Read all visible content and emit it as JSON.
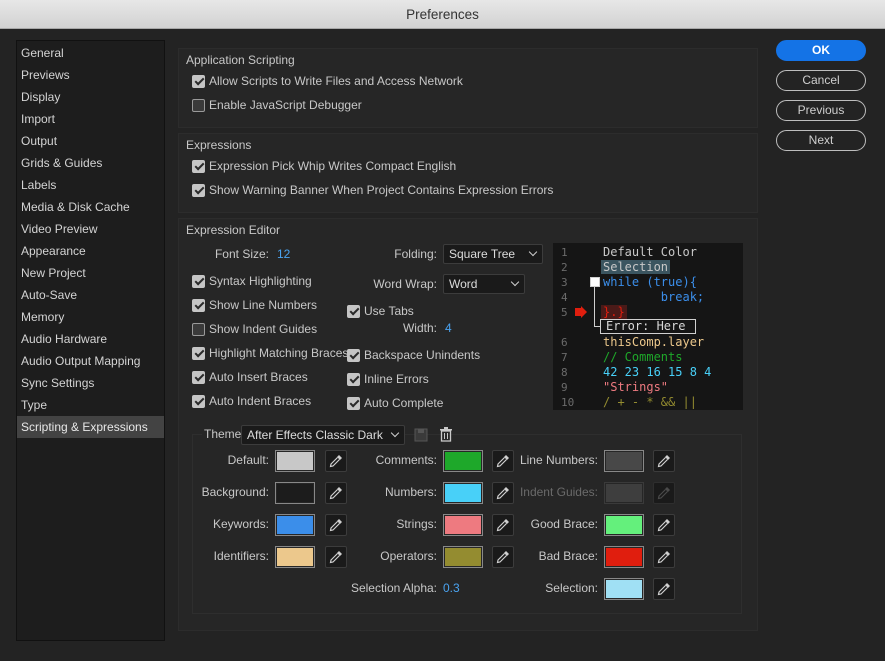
{
  "window": {
    "title": "Preferences"
  },
  "sidebar": {
    "items": [
      {
        "label": "General"
      },
      {
        "label": "Previews"
      },
      {
        "label": "Display"
      },
      {
        "label": "Import"
      },
      {
        "label": "Output"
      },
      {
        "label": "Grids & Guides"
      },
      {
        "label": "Labels"
      },
      {
        "label": "Media & Disk Cache"
      },
      {
        "label": "Video Preview"
      },
      {
        "label": "Appearance"
      },
      {
        "label": "New Project"
      },
      {
        "label": "Auto-Save"
      },
      {
        "label": "Memory"
      },
      {
        "label": "Audio Hardware"
      },
      {
        "label": "Audio Output Mapping"
      },
      {
        "label": "Sync Settings"
      },
      {
        "label": "Type"
      },
      {
        "label": "Scripting & Expressions"
      }
    ],
    "selected": "Scripting & Expressions"
  },
  "app_scripting": {
    "title": "Application Scripting",
    "allow_scripts": {
      "label": "Allow Scripts to Write Files and Access Network",
      "checked": true
    },
    "enable_debugger": {
      "label": "Enable JavaScript Debugger",
      "checked": false
    }
  },
  "expressions": {
    "title": "Expressions",
    "pick_whip": {
      "label": "Expression Pick Whip Writes Compact English",
      "checked": true
    },
    "warning_banner": {
      "label": "Show Warning Banner When Project Contains Expression Errors",
      "checked": true
    }
  },
  "editor": {
    "title": "Expression Editor",
    "font_size_label": "Font Size:",
    "font_size_value": "12",
    "folding_label": "Folding:",
    "folding_value": "Square Tree",
    "word_wrap_label": "Word Wrap:",
    "word_wrap_value": "Word",
    "width_label": "Width:",
    "width_value": "4",
    "syntax_highlighting": {
      "label": "Syntax Highlighting",
      "checked": true
    },
    "show_line_numbers": {
      "label": "Show Line Numbers",
      "checked": true
    },
    "show_indent_guides": {
      "label": "Show Indent Guides",
      "checked": false
    },
    "highlight_braces": {
      "label": "Highlight Matching Braces",
      "checked": true
    },
    "auto_insert_braces": {
      "label": "Auto Insert Braces",
      "checked": true
    },
    "auto_indent_braces": {
      "label": "Auto Indent Braces",
      "checked": true
    },
    "use_tabs": {
      "label": "Use Tabs",
      "checked": true
    },
    "backspace_unindents": {
      "label": "Backspace Unindents",
      "checked": true
    },
    "inline_errors": {
      "label": "Inline Errors",
      "checked": true
    },
    "auto_complete": {
      "label": "Auto Complete",
      "checked": true
    },
    "preview": {
      "line_numbers": [
        "1",
        "2",
        "3",
        "4",
        "5",
        "6",
        "7",
        "8",
        "9",
        "10"
      ],
      "lines": [
        "Default Color",
        "Selection",
        "while (true){",
        "        break;",
        "}.}",
        "Error: Here",
        "thisComp.layer",
        "// Comments",
        "42 23 16 15 8 4",
        "\"Strings\"",
        "/ + - * && ||"
      ]
    }
  },
  "theme": {
    "label": "Theme:",
    "value": "After Effects Classic Dark",
    "colors": {
      "default": {
        "label": "Default:",
        "hex": "#c8c8c8"
      },
      "background": {
        "label": "Background:",
        "hex": "#1c1c1c"
      },
      "keywords": {
        "label": "Keywords:",
        "hex": "#3b8eea"
      },
      "identifiers": {
        "label": "Identifiers:",
        "hex": "#ecc88c"
      },
      "comments": {
        "label": "Comments:",
        "hex": "#1ea82a"
      },
      "numbers": {
        "label": "Numbers:",
        "hex": "#48d0f8"
      },
      "strings": {
        "label": "Strings:",
        "hex": "#ee7a80"
      },
      "operators": {
        "label": "Operators:",
        "hex": "#948c30"
      },
      "line_numbers": {
        "label": "Line Numbers:",
        "hex": "#484848"
      },
      "indent_guides": {
        "label": "Indent Guides:",
        "hex": "#3e3e3e"
      },
      "good_brace": {
        "label": "Good Brace:",
        "hex": "#64f07c"
      },
      "bad_brace": {
        "label": "Bad Brace:",
        "hex": "#e01e0e"
      },
      "selection": {
        "label": "Selection:",
        "hex": "#a0e0f4"
      }
    },
    "selection_alpha_label": "Selection Alpha:",
    "selection_alpha_value": "0.3"
  },
  "buttons": {
    "ok": "OK",
    "cancel": "Cancel",
    "previous": "Previous",
    "next": "Next"
  }
}
